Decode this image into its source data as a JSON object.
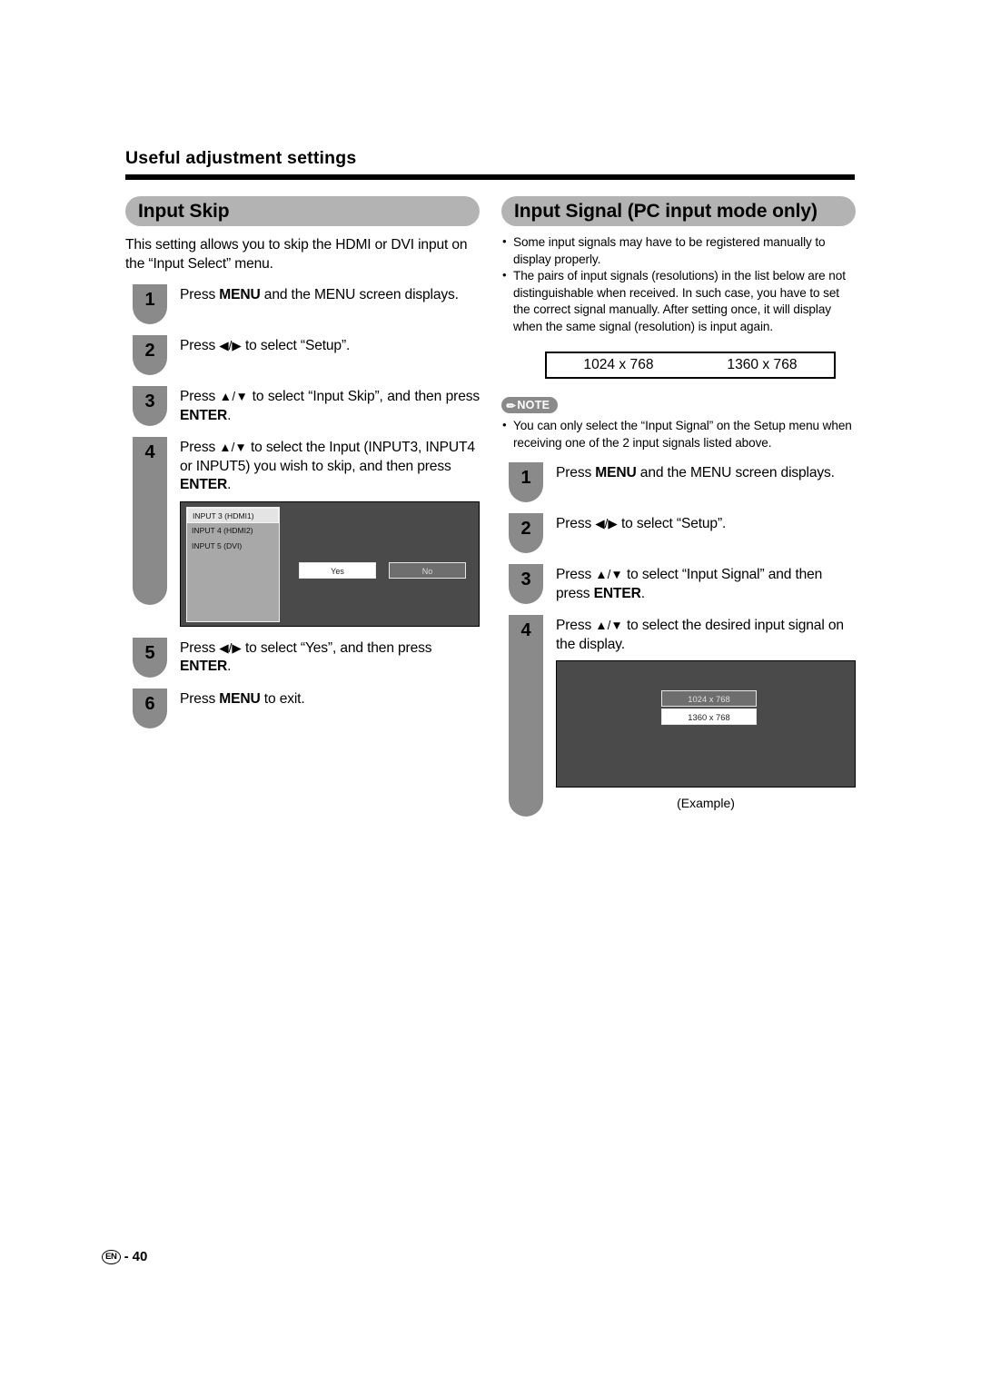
{
  "running_head": "Useful adjustment settings",
  "left": {
    "section_title": "Input Skip",
    "intro": "This setting allows you to skip the HDMI or DVI input on the “Input Select” menu.",
    "steps": [
      {
        "num": "1",
        "text_html": "Press <b>MENU</b> and the MENU screen displays."
      },
      {
        "num": "2",
        "text_html": "Press <span class=\"arrows\">◀/▶</span> to select “Setup”."
      },
      {
        "num": "3",
        "text_html": "Press <span class=\"arrows\">▲/▼</span> to select “Input Skip”, and then press <b>ENTER</b>."
      },
      {
        "num": "4",
        "text_html": "Press <span class=\"arrows\">▲/▼</span> to select the Input (INPUT3, INPUT4 or INPUT5) you wish to skip, and then press <b>ENTER</b>."
      },
      {
        "num": "5",
        "text_html": "Press <span class=\"arrows\">◀/▶</span> to select “Yes”, and then press <b>ENTER</b>."
      },
      {
        "num": "6",
        "text_html": "Press <b>MENU</b> to exit."
      }
    ],
    "osd": {
      "items": [
        {
          "label": "INPUT 3 (HDMI1)",
          "selected": true
        },
        {
          "label": "INPUT 4 (HDMI2)",
          "selected": false
        },
        {
          "label": "INPUT 5 (DVI)",
          "selected": false
        }
      ],
      "yes_label": "Yes",
      "no_label": "No"
    }
  },
  "right": {
    "section_title": "Input Signal (PC input mode only)",
    "bullets": [
      "Some input signals may have to be registered manually to display properly.",
      "The pairs of input signals (resolutions) in the list below are not distinguishable when received. In such case, you have to set the correct signal manually. After setting once, it will display when the same signal (resolution) is input again."
    ],
    "resolution_table": [
      "1024 x 768",
      "1360 x 768"
    ],
    "note": {
      "label": "NOTE",
      "bullets": [
        "You can only select the “Input Signal” on the Setup menu when receiving one of the 2 input signals listed above."
      ]
    },
    "steps": [
      {
        "num": "1",
        "text_html": "Press <b>MENU</b> and the MENU screen displays."
      },
      {
        "num": "2",
        "text_html": "Press <span class=\"arrows\">◀/▶</span> to select “Setup”."
      },
      {
        "num": "3",
        "text_html": "Press <span class=\"arrows\">▲/▼</span> to select “Input Signal” and then press <b>ENTER</b>."
      },
      {
        "num": "4",
        "text_html": "Press <span class=\"arrows\">▲/▼</span> to select the desired input signal on the display."
      }
    ],
    "osd": {
      "options": [
        {
          "label": "1024 x 768",
          "selected": true
        },
        {
          "label": "1360 x 768",
          "selected": false
        }
      ],
      "caption": "(Example)"
    }
  },
  "footer": {
    "lang": "EN",
    "separator": "-",
    "page": "40"
  },
  "colors": {
    "badge_gray": "#8a8a8a",
    "header_gray": "#b3b3b3",
    "osd_bg": "#4a4a4a",
    "osd_list": "#a8a8a8"
  }
}
